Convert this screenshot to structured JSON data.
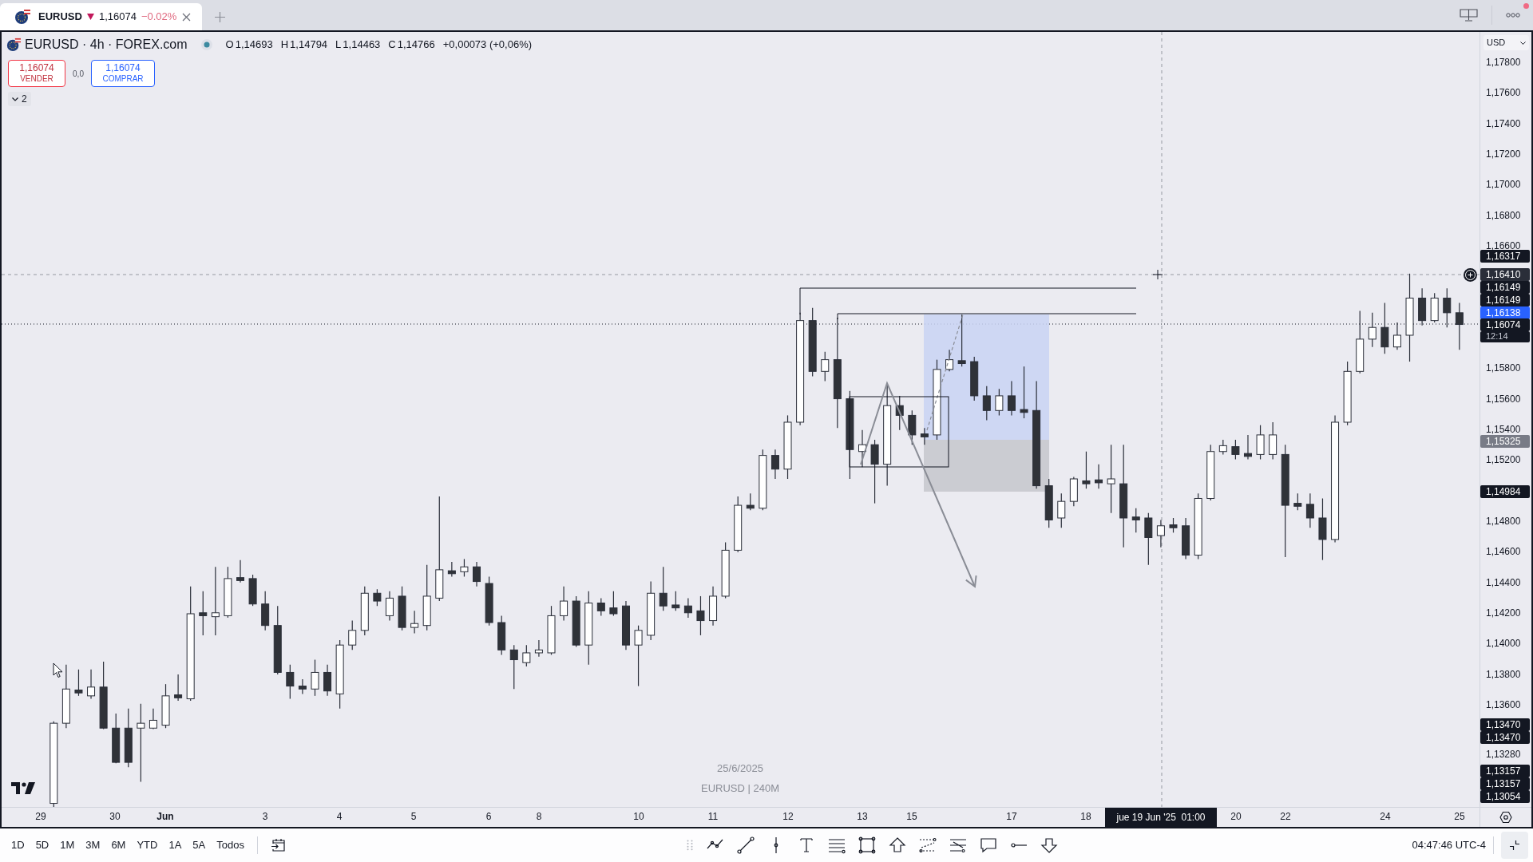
{
  "tab": {
    "symbol": "EURUSD",
    "price": "1,16074",
    "change": "−0.02%",
    "falling": true
  },
  "legend": {
    "title": "EURUSD · 4h · FOREX.com",
    "ohlc": [
      {
        "label": "O",
        "value": "1,14693"
      },
      {
        "label": "H",
        "value": "1,14794"
      },
      {
        "label": "L",
        "value": "1,14463"
      },
      {
        "label": "C",
        "value": "1,14766"
      }
    ],
    "change": "+0,00073 (+0,06%)"
  },
  "trade": {
    "sell": {
      "price": "1,16074",
      "label": "VENDER"
    },
    "spread": "0,0",
    "buy": {
      "price": "1,16074",
      "label": "COMPRAR"
    }
  },
  "indicators_toggle": {
    "count": "2"
  },
  "chart_caption": {
    "date": "25/6/2025",
    "symbol": "EURUSD | 240M"
  },
  "price_axis": {
    "currency": "USD",
    "ticks": [
      "1,17800",
      "1,17600",
      "1,17400",
      "1,17200",
      "1,17000",
      "1,16800",
      "1,16600",
      "1,15800",
      "1,15600",
      "1,15400",
      "1,15200",
      "1,14800",
      "1,14600",
      "1,14400",
      "1,14200",
      "1,14000",
      "1,13800",
      "1,13600"
    ],
    "markers": [
      {
        "kind": "dark",
        "label": "1,16317"
      },
      {
        "kind": "crosshair",
        "label": "1,16410"
      },
      {
        "kind": "dark",
        "label": "1,16149"
      },
      {
        "kind": "dark",
        "label": "1,16149"
      },
      {
        "kind": "blue",
        "label": "1,16138"
      },
      {
        "kind": "dark",
        "label": "1,16074",
        "countdown": "12:14"
      },
      {
        "kind": "gray",
        "label": "1,15325"
      },
      {
        "kind": "dark",
        "label": "1,14984"
      },
      {
        "kind": "dark",
        "label": "1,13470"
      },
      {
        "kind": "dark",
        "label": "1,13470"
      },
      {
        "kind": "plain",
        "label": "1,13280"
      },
      {
        "kind": "dark",
        "label": "1,13157"
      },
      {
        "kind": "dark",
        "label": "1,13157"
      },
      {
        "kind": "dark",
        "label": "1,13054"
      }
    ]
  },
  "time_axis": {
    "labels": [
      {
        "kind": "day",
        "text": "29"
      },
      {
        "kind": "day",
        "text": "30"
      },
      {
        "kind": "month",
        "text": "Jun"
      },
      {
        "kind": "day",
        "text": "3"
      },
      {
        "kind": "day",
        "text": "4"
      },
      {
        "kind": "day",
        "text": "5"
      },
      {
        "kind": "day",
        "text": "6"
      },
      {
        "kind": "day",
        "text": "8"
      },
      {
        "kind": "day",
        "text": "10"
      },
      {
        "kind": "day",
        "text": "11"
      },
      {
        "kind": "day",
        "text": "12"
      },
      {
        "kind": "day",
        "text": "13"
      },
      {
        "kind": "day",
        "text": "15"
      },
      {
        "kind": "day",
        "text": "17"
      },
      {
        "kind": "day",
        "text": "18"
      },
      {
        "kind": "day",
        "text": "20"
      },
      {
        "kind": "day",
        "text": "22"
      },
      {
        "kind": "day",
        "text": "24"
      },
      {
        "kind": "day",
        "text": "25"
      }
    ],
    "crosshair_label": "jue 19 Jun '25  01:00"
  },
  "range_buttons": [
    "1D",
    "5D",
    "1M",
    "3M",
    "6M",
    "YTD",
    "1A",
    "5A",
    "Todos"
  ],
  "clock": "04:47:46 UTC-4"
}
